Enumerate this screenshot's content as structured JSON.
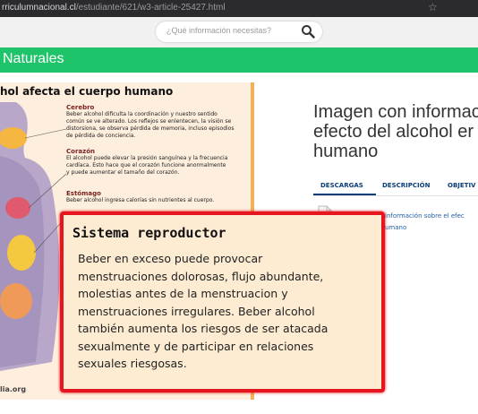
{
  "browser": {
    "url_domain": "rriculumnacional.cl",
    "url_path": "/estudiante/621/w3-article-25427.html"
  },
  "header": {
    "search_placeholder": "¿Qué información necesitas?"
  },
  "section_bar": {
    "title": "Naturales"
  },
  "infographic": {
    "title": "hol afecta el cuerpo humano",
    "organs": [
      {
        "name": "Cerebro",
        "text": [
          "Beber alcohol dificulta la coordinación y nuestro sentido",
          "común se ve alterado. Los reflejos se enlentecen, la visión se",
          "distorsiona, se observa pérdida de memoria, incluso episodios",
          "de pérdida de conciencia."
        ]
      },
      {
        "name": "Corazón",
        "text": [
          "El alcohol puede elevar la presión sanguínea y la frecuencia",
          "cardíaca. Esto hace que el corazón funcione anormalmente",
          "y puede aumentar el tamaño del corazón."
        ]
      },
      {
        "name": "Estómago",
        "text": [
          "Beber alcohol ingresa calorías sin nutrientes al cuerpo."
        ]
      }
    ],
    "credit": "lia.org"
  },
  "resource": {
    "title_lines": [
      "Imagen con informac",
      "efecto del alcohol er",
      "humano"
    ],
    "tabs": [
      "DESCARGAS",
      "DESCRIPCIÓN",
      "OBJETIV"
    ],
    "active_tab": "DESCARGAS",
    "description_lines": [
      "información sobre el efec",
      "umano"
    ]
  },
  "callout": {
    "title": "Sistema reproductor",
    "body_lines": [
      "Beber en exceso puede provocar",
      "menstruaciones dolorosas, flujo abundante,",
      "molestias antes de la menstruacion y",
      "menstruaciones irregulares.  Beber alcohol",
      "también aumenta los riesgos de ser atacada",
      "sexualmente y de participar en relaciones",
      "sexuales riesgosas."
    ],
    "border_color": "#e5161f"
  },
  "colors": {
    "green": "#1fc36a",
    "link_blue": "#1f5fa6",
    "tab_blue": "#0a3d7a"
  },
  "icons": [
    "search-icon",
    "star-icon",
    "document-icon",
    "body-illustration"
  ]
}
